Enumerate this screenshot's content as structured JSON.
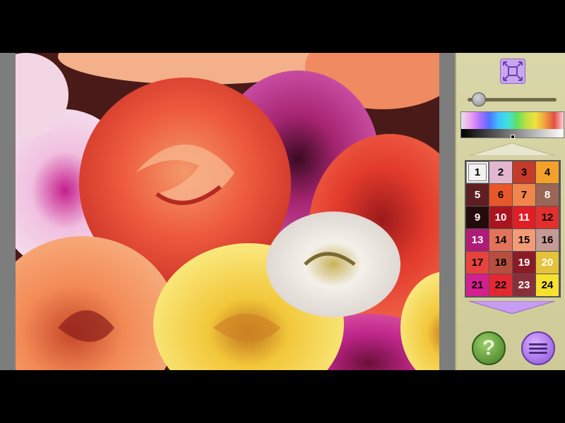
{
  "game": {
    "artwork_subject": "roses",
    "zoom_level_fraction": 0.1
  },
  "toolbar": {
    "fit_icon": "fit-to-screen-icon",
    "help_icon": "question-icon",
    "help_label": "?",
    "menu_icon": "hamburger-menu-icon"
  },
  "palette": {
    "selected": "1",
    "swatches": [
      {
        "label": "1",
        "bg": "#f2f2f2",
        "fg": "#000000"
      },
      {
        "label": "2",
        "bg": "#e3b6cf",
        "fg": "#000000"
      },
      {
        "label": "3",
        "bg": "#c53a29",
        "fg": "#000000"
      },
      {
        "label": "4",
        "bg": "#f4a12b",
        "fg": "#000000"
      },
      {
        "label": "5",
        "bg": "#5e1f22",
        "fg": "#ffffff"
      },
      {
        "label": "6",
        "bg": "#e8572a",
        "fg": "#000000"
      },
      {
        "label": "7",
        "bg": "#f2854b",
        "fg": "#000000"
      },
      {
        "label": "8",
        "bg": "#9a6655",
        "fg": "#ffffff"
      },
      {
        "label": "9",
        "bg": "#260b0d",
        "fg": "#ffffff"
      },
      {
        "label": "10",
        "bg": "#a9141f",
        "fg": "#ffffff"
      },
      {
        "label": "11",
        "bg": "#e11d26",
        "fg": "#ffffff"
      },
      {
        "label": "12",
        "bg": "#e2302c",
        "fg": "#000000"
      },
      {
        "label": "13",
        "bg": "#b11b78",
        "fg": "#ffffff"
      },
      {
        "label": "14",
        "bg": "#e2735a",
        "fg": "#000000"
      },
      {
        "label": "15",
        "bg": "#f29b76",
        "fg": "#000000"
      },
      {
        "label": "16",
        "bg": "#c49a94",
        "fg": "#000000"
      },
      {
        "label": "17",
        "bg": "#e8423c",
        "fg": "#000000"
      },
      {
        "label": "18",
        "bg": "#b84e3f",
        "fg": "#000000"
      },
      {
        "label": "19",
        "bg": "#8a1c26",
        "fg": "#ffffff"
      },
      {
        "label": "20",
        "bg": "#e6c23a",
        "fg": "#ffffff"
      },
      {
        "label": "21",
        "bg": "#d41f8f",
        "fg": "#000000"
      },
      {
        "label": "22",
        "bg": "#e32833",
        "fg": "#000000"
      },
      {
        "label": "23",
        "bg": "#87303b",
        "fg": "#ffffff"
      },
      {
        "label": "24",
        "bg": "#f6e12e",
        "fg": "#000000"
      }
    ]
  }
}
